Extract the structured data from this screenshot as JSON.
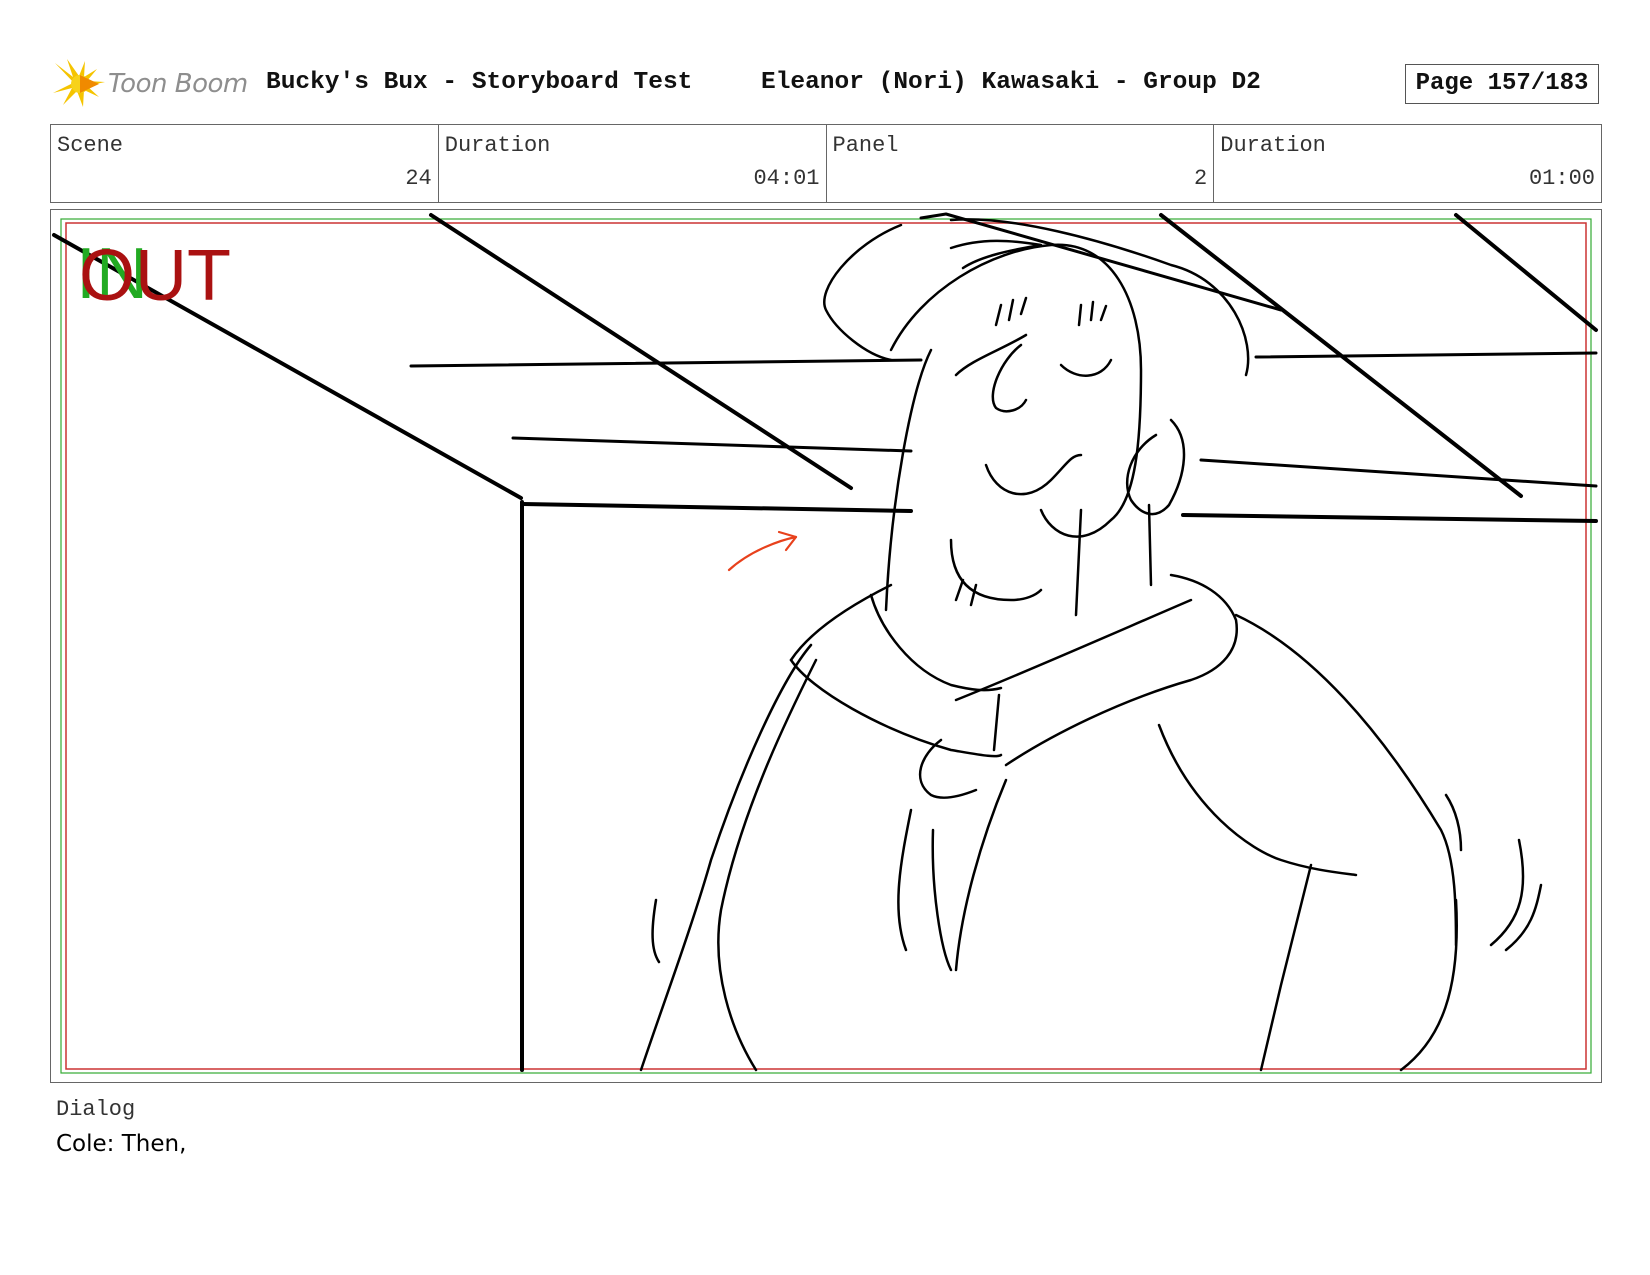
{
  "header": {
    "logo_text": "Toon Boom",
    "title": "Bucky's Bux - Storyboard Test",
    "author": "Eleanor (Nori) Kawasaki - Group D2",
    "page": "Page 157/183"
  },
  "info": {
    "scene_label": "Scene",
    "scene_value": "24",
    "scene_duration_label": "Duration",
    "scene_duration_value": "04:01",
    "panel_label": "Panel",
    "panel_value": "2",
    "panel_duration_label": "Duration",
    "panel_duration_value": "01:00"
  },
  "panel": {
    "in_marker": "IN",
    "out_marker": "OUT",
    "colors": {
      "in": "#22aa22",
      "out": "#aa1111",
      "arrow": "#e8411c",
      "safe_red": "#cc3333",
      "safe_green": "#33aa33"
    }
  },
  "dialog": {
    "label": "Dialog",
    "text": "Cole: Then,"
  }
}
